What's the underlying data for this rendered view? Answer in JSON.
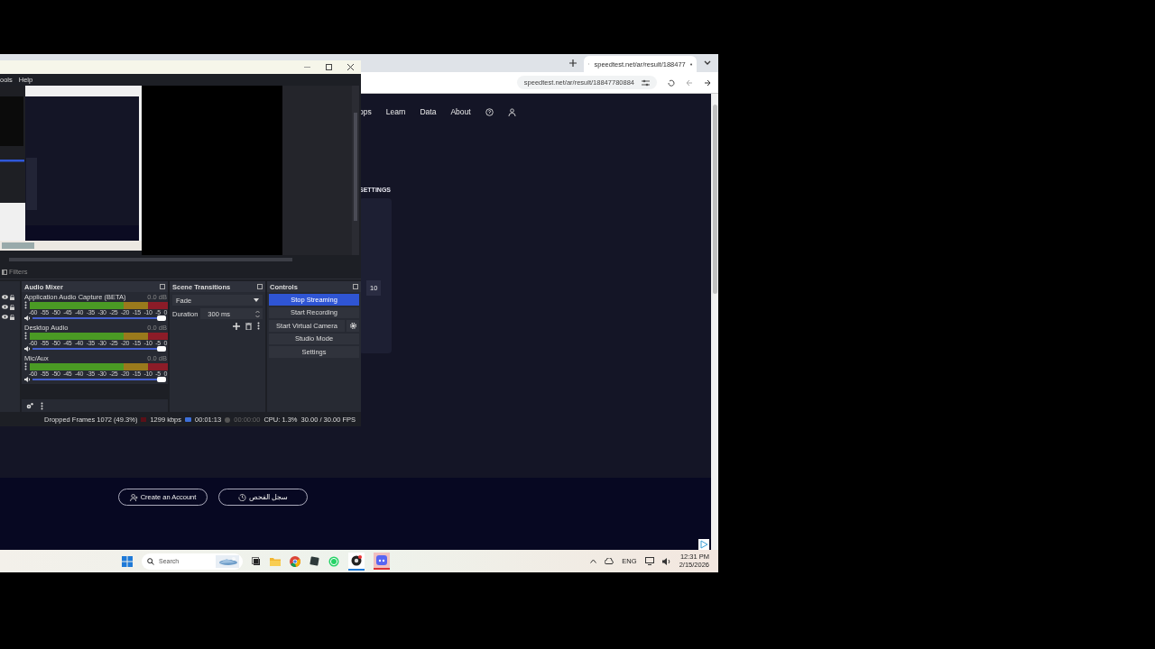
{
  "obs": {
    "menu": [
      "ools",
      "Help"
    ],
    "filters_label": "Filters",
    "audio_mixer": {
      "title": "Audio Mixer",
      "channels": [
        {
          "name": "Application Audio Capture (BETA)",
          "reading": "0.0 dB",
          "level": 1,
          "scale": [
            "-60",
            "-55",
            "-50",
            "-45",
            "-40",
            "-35",
            "-30",
            "-25",
            "-20",
            "-15",
            "-10",
            "-5",
            "0"
          ]
        },
        {
          "name": "Desktop Audio",
          "reading": "0.0 dB",
          "level": 1,
          "scale": [
            "-60",
            "-55",
            "-50",
            "-45",
            "-40",
            "-35",
            "-30",
            "-25",
            "-20",
            "-15",
            "-10",
            "-5",
            "0"
          ]
        },
        {
          "name": "Mic/Aux",
          "reading": "0.0 dB",
          "level": 1,
          "scale": [
            "-60",
            "-55",
            "-50",
            "-45",
            "-40",
            "-35",
            "-30",
            "-25",
            "-20",
            "-15",
            "-10",
            "-5",
            "0"
          ]
        }
      ]
    },
    "scene_transitions": {
      "title": "Scene Transitions",
      "transition": "Fade",
      "duration_label": "Duration",
      "duration": "300 ms"
    },
    "controls": {
      "title": "Controls",
      "buttons": [
        {
          "label": "Stop Streaming",
          "active": true,
          "has_settings": false
        },
        {
          "label": "Start Recording",
          "active": false,
          "has_settings": false
        },
        {
          "label": "Start Virtual Camera",
          "active": false,
          "has_settings": true
        },
        {
          "label": "Studio Mode",
          "active": false,
          "has_settings": false
        },
        {
          "label": "Settings",
          "active": false,
          "has_settings": false
        }
      ]
    },
    "status_bar": {
      "dropped_frames": "Dropped Frames 1072 (49.3%)",
      "bitrate": "1299 kbps",
      "stream_time": "00:01:13",
      "record_time": "00:00:00",
      "cpu": "CPU: 1.3%",
      "fps": "30.00 / 30.00 FPS"
    }
  },
  "browser": {
    "tab_title": "speedtest.net/ar/result/188477",
    "address": "speedtest.net/ar/result/18847780884",
    "nav": [
      "ops",
      "Learn",
      "Data",
      "About"
    ],
    "section_heading": "SETTINGS",
    "card_buttons": [
      "10"
    ],
    "bottom_buttons": [
      "Create an Account",
      "سجل الفحص"
    ]
  },
  "taskbar": {
    "search_placeholder": "Search",
    "language": "ENG",
    "time": "12:31 PM",
    "date": "2/15/2026"
  }
}
